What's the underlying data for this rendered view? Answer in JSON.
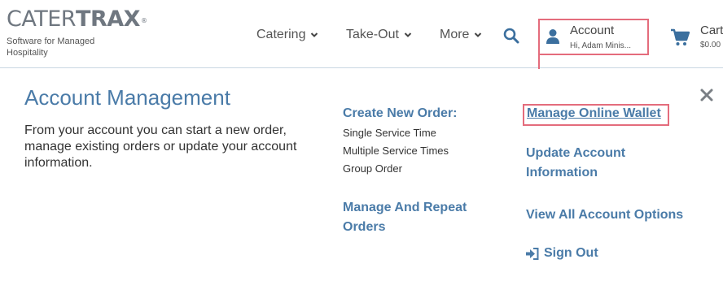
{
  "brand": {
    "name_part1": "CATER",
    "name_part2": "TRAX",
    "registered": "®",
    "tagline": "Software for Managed Hospitality"
  },
  "nav": {
    "catering": "Catering",
    "takeout": "Take-Out",
    "more": "More"
  },
  "account": {
    "label": "Account",
    "greeting": "Hi, Adam Minis..."
  },
  "cart": {
    "label": "Cart",
    "amount": "$0.00"
  },
  "panel": {
    "title": "Account Management",
    "description": "From your account you can start a new order, manage existing orders or update your account information.",
    "create_heading": "Create New Order:",
    "create_links": [
      "Single Service Time",
      "Multiple Service Times",
      "Group Order"
    ],
    "manage_heading": "Manage And Repeat Orders",
    "wallet": "Manage Online Wallet",
    "update_account": "Update Account Information",
    "view_all": "View All Account Options",
    "sign_out": "Sign Out"
  },
  "colors": {
    "accent_blue": "#4a7ba8",
    "highlight_red": "#e46c7c",
    "logo_gray": "#6f7780",
    "icon_blue": "#3b6f9e"
  },
  "icons": {
    "chevron": "chevron-down-icon",
    "search": "search-icon",
    "account": "user-icon",
    "cart": "cart-icon",
    "close": "close-icon",
    "sign_out": "sign-out-icon"
  }
}
